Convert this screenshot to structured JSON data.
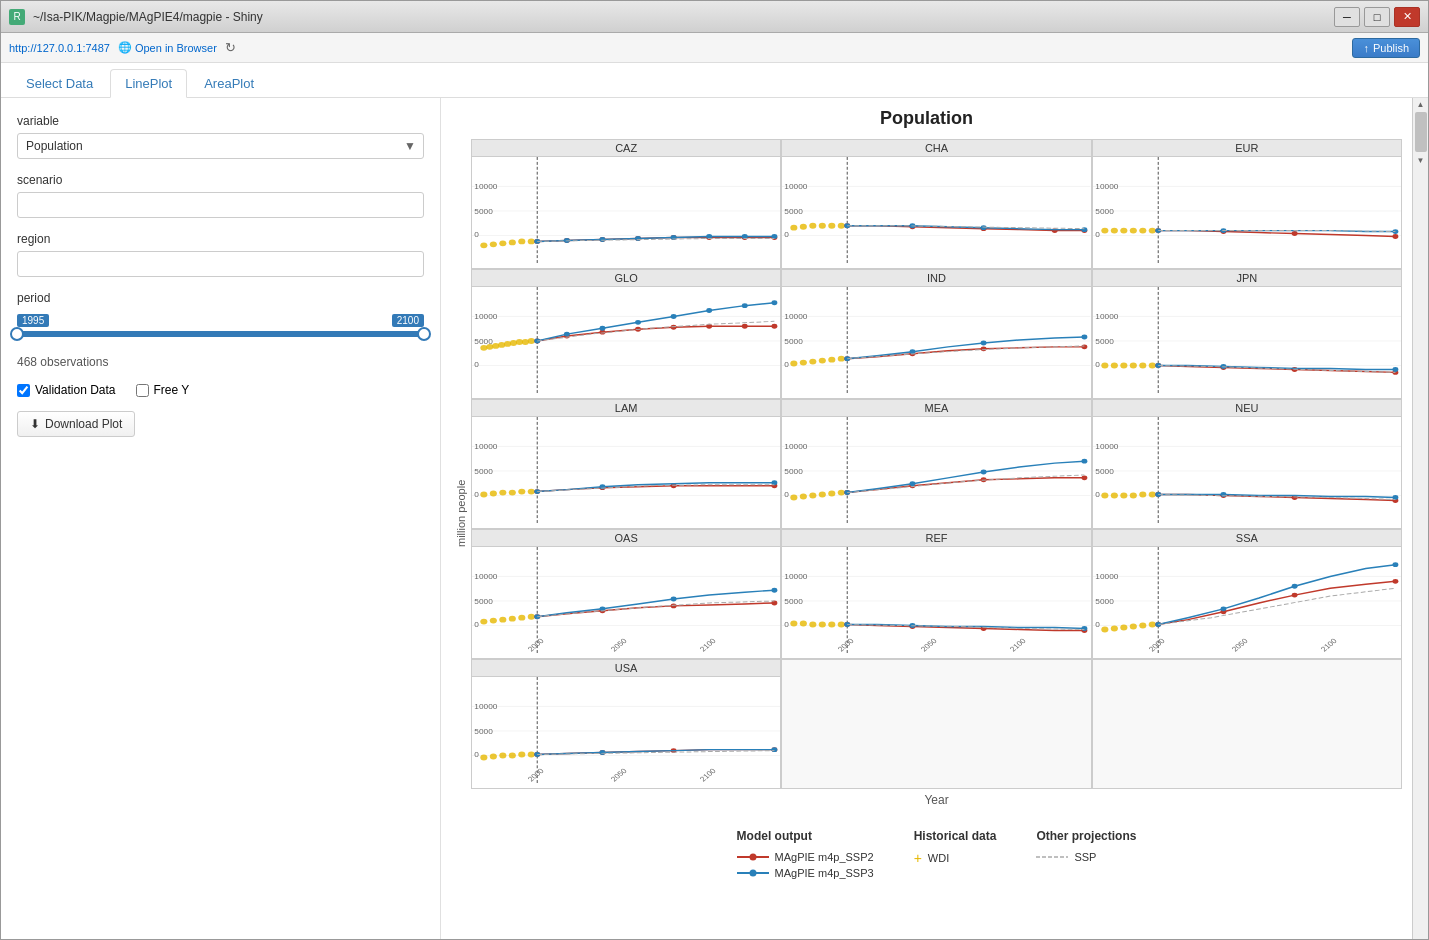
{
  "window": {
    "title": "~/Isa-PIK/Magpie/MAgPIE4/magpie - Shiny",
    "address": "http://127.0.0.1:7487"
  },
  "toolbar": {
    "open_browser": "Open in Browser",
    "publish_label": "Publish"
  },
  "tabs": [
    {
      "id": "select-data",
      "label": "Select Data",
      "active": false
    },
    {
      "id": "lineplot",
      "label": "LinePlot",
      "active": true
    },
    {
      "id": "areaplot",
      "label": "AreaPlot",
      "active": false
    }
  ],
  "sidebar": {
    "variable_label": "variable",
    "variable_value": "Population",
    "scenario_label": "scenario",
    "scenario_value": "",
    "region_label": "region",
    "region_value": "",
    "period_label": "period",
    "period_min": "1995",
    "period_max": "2100",
    "observations": "468 observations",
    "validation_data_label": "Validation Data",
    "free_y_label": "Free Y",
    "download_plot_label": "Download Plot"
  },
  "plot": {
    "title": "Population",
    "y_axis_label": "million people",
    "x_axis_label": "Year",
    "regions": [
      {
        "id": "CAZ",
        "label": "CAZ"
      },
      {
        "id": "CHA",
        "label": "CHA"
      },
      {
        "id": "EUR",
        "label": "EUR"
      },
      {
        "id": "GLO",
        "label": "GLO"
      },
      {
        "id": "IND",
        "label": "IND"
      },
      {
        "id": "JPN",
        "label": "JPN"
      },
      {
        "id": "LAM",
        "label": "LAM"
      },
      {
        "id": "MEA",
        "label": "MEA"
      },
      {
        "id": "NEU",
        "label": "NEU"
      },
      {
        "id": "OAS",
        "label": "OAS"
      },
      {
        "id": "REF",
        "label": "REF"
      },
      {
        "id": "SSA",
        "label": "SSA"
      },
      {
        "id": "USA",
        "label": "USA"
      }
    ]
  },
  "legend": {
    "model_output_title": "Model output",
    "historical_data_title": "Historical data",
    "other_projections_title": "Other projections",
    "items": [
      {
        "label": "MAgPIE m4p_SSP2",
        "type": "red-line"
      },
      {
        "label": "MAgPIE m4p_SSP3",
        "type": "blue-line"
      },
      {
        "label": "WDI",
        "type": "yellow-plus"
      },
      {
        "label": "SSP",
        "type": "gray-line"
      }
    ]
  },
  "icons": {
    "minimize": "─",
    "maximize": "□",
    "close": "✕",
    "refresh": "↻",
    "download": "⬇",
    "globe": "🌐",
    "publish_icon": "↑"
  }
}
